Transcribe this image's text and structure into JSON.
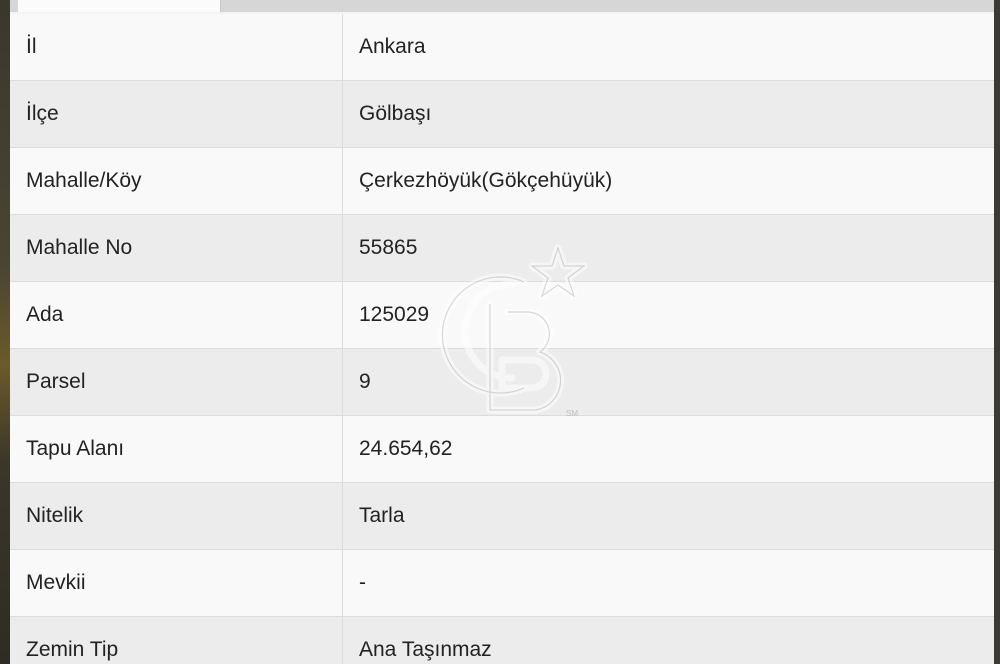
{
  "colors": {
    "row_light": "#f9f9f9",
    "row_dark": "#ececec",
    "text": "#222222",
    "border": "#dcdcdc"
  },
  "watermark": {
    "icon": "cb-logo-icon",
    "text": "CB",
    "mark": "SM"
  },
  "rows": [
    {
      "label": "İl",
      "value": "Ankara"
    },
    {
      "label": "İlçe",
      "value": "Gölbaşı"
    },
    {
      "label": "Mahalle/Köy",
      "value": "Çerkezhöyük(Gökçehüyük)"
    },
    {
      "label": "Mahalle No",
      "value": "55865"
    },
    {
      "label": "Ada",
      "value": "125029"
    },
    {
      "label": "Parsel",
      "value": "9"
    },
    {
      "label": "Tapu Alanı",
      "value": "24.654,62"
    },
    {
      "label": "Nitelik",
      "value": "Tarla"
    },
    {
      "label": "Mevkii",
      "value": "-"
    },
    {
      "label": "Zemin Tip",
      "value": "Ana Taşınmaz"
    }
  ]
}
